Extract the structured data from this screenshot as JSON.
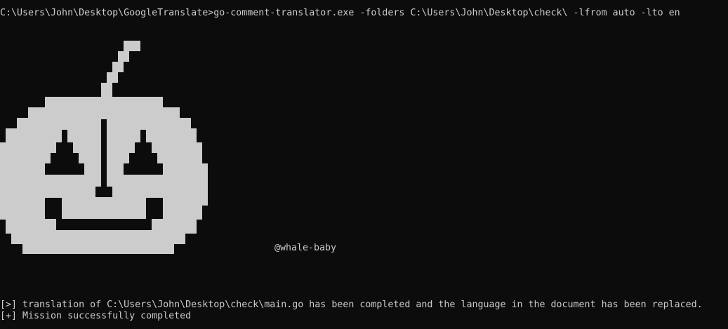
{
  "console": {
    "command_line": "C:\\Users\\John\\Desktop\\GoogleTranslate>go-comment-translator.exe -folders C:\\Users\\John\\Desktop\\check\\ -lfrom auto -lto en",
    "signature": "@whale-baby",
    "output_lines": [
      "[>] translation of C:\\Users\\John\\Desktop\\check\\main.go has been completed and the language in the document has been replaced.",
      "[+] Mission successfully completed"
    ]
  },
  "ascii_art": {
    "subject": "pumpkin-face",
    "fill_color": "#cccccc",
    "background_color": "#0c0c0c"
  }
}
